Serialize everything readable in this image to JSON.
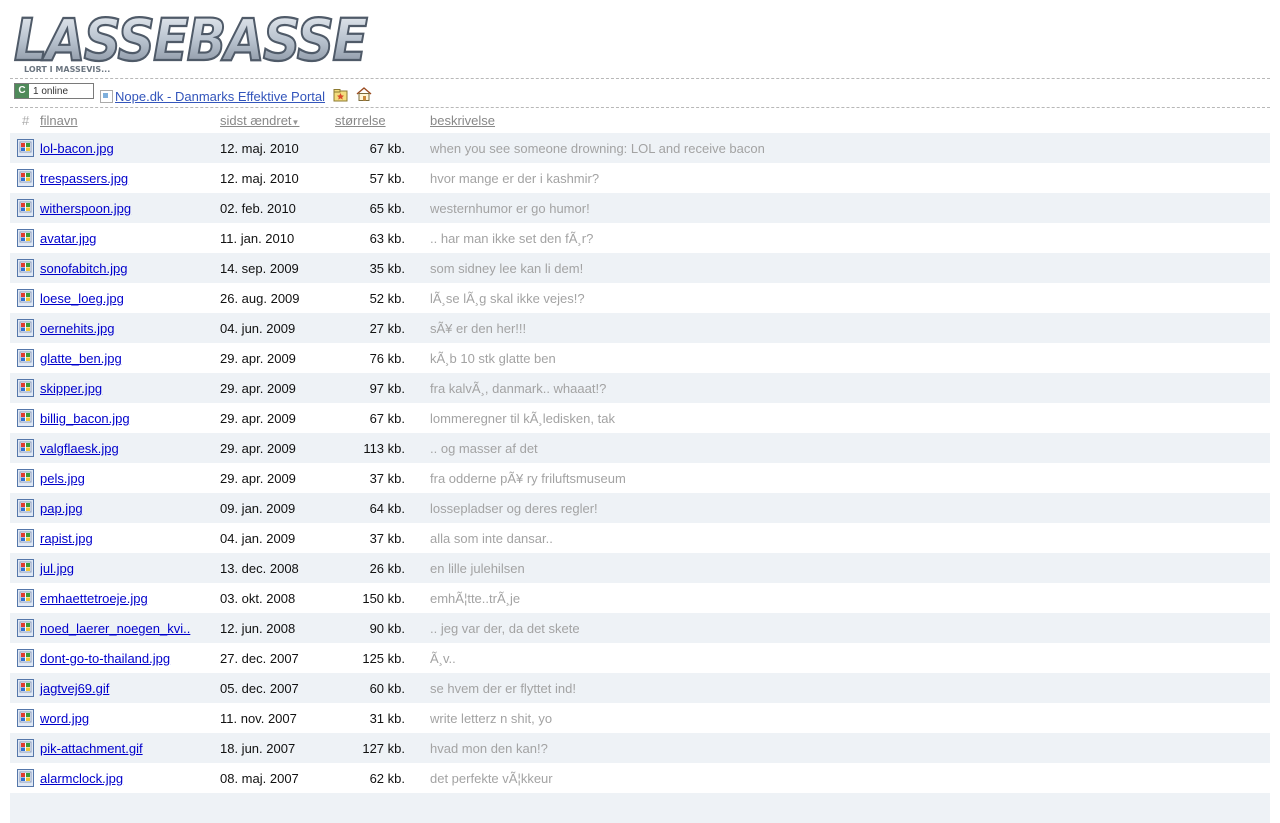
{
  "logo": {
    "main": "LASSEBASSE",
    "tagline": "LORT I MASSEVIS..."
  },
  "counter": {
    "badge": "C",
    "text": "1 online"
  },
  "portal_link": "Nope.dk - Danmarks Effektive Portal",
  "icons": [
    "counter-icon",
    "broken-image-icon",
    "folder-star-icon",
    "home-icon",
    "image-file-icon"
  ],
  "columns": {
    "num": "#",
    "filename": "filnavn",
    "modified": "sidst ændret",
    "size": "størrelse",
    "description": "beskrivelse"
  },
  "files": [
    {
      "name": "lol-bacon.jpg",
      "date": "12. maj. 2010",
      "size": "67 kb.",
      "desc": "when you see someone drowning: LOL and receive bacon"
    },
    {
      "name": "trespassers.jpg",
      "date": "12. maj. 2010",
      "size": "57 kb.",
      "desc": "hvor mange er der i kashmir?"
    },
    {
      "name": "witherspoon.jpg",
      "date": "02. feb. 2010",
      "size": "65 kb.",
      "desc": "westernhumor er go humor!"
    },
    {
      "name": "avatar.jpg",
      "date": "11. jan. 2010",
      "size": "63 kb.",
      "desc": ".. har man ikke set den fÃ¸r?"
    },
    {
      "name": "sonofabitch.jpg",
      "date": "14. sep. 2009",
      "size": "35 kb.",
      "desc": "som sidney lee kan li dem!"
    },
    {
      "name": "loese_loeg.jpg",
      "date": "26. aug. 2009",
      "size": "52 kb.",
      "desc": "lÃ¸se lÃ¸g skal ikke vejes!?"
    },
    {
      "name": "oernehits.jpg",
      "date": "04. jun. 2009",
      "size": "27 kb.",
      "desc": "sÃ¥ er den her!!!"
    },
    {
      "name": "glatte_ben.jpg",
      "date": "29. apr. 2009",
      "size": "76 kb.",
      "desc": "kÃ¸b 10 stk glatte ben"
    },
    {
      "name": "skipper.jpg",
      "date": "29. apr. 2009",
      "size": "97 kb.",
      "desc": "fra kalvÃ¸, danmark.. whaaat!?"
    },
    {
      "name": "billig_bacon.jpg",
      "date": "29. apr. 2009",
      "size": "67 kb.",
      "desc": "lommeregner til kÃ¸ledisken, tak"
    },
    {
      "name": "valgflaesk.jpg",
      "date": "29. apr. 2009",
      "size": "113 kb.",
      "desc": ".. og masser af det"
    },
    {
      "name": "pels.jpg",
      "date": "29. apr. 2009",
      "size": "37 kb.",
      "desc": "fra odderne pÃ¥ ry friluftsmuseum"
    },
    {
      "name": "pap.jpg",
      "date": "09. jan. 2009",
      "size": "64 kb.",
      "desc": "lossepladser og deres regler!"
    },
    {
      "name": "rapist.jpg",
      "date": "04. jan. 2009",
      "size": "37 kb.",
      "desc": "alla som inte dansar.."
    },
    {
      "name": "jul.jpg",
      "date": "13. dec. 2008",
      "size": "26 kb.",
      "desc": "en lille julehilsen"
    },
    {
      "name": "emhaettetroeje.jpg",
      "date": "03. okt. 2008",
      "size": "150 kb.",
      "desc": "emhÃ¦tte..trÃ¸je"
    },
    {
      "name": "noed_laerer_noegen_kvi..",
      "date": "12. jun. 2008",
      "size": "90 kb.",
      "desc": ".. jeg var der, da det skete"
    },
    {
      "name": "dont-go-to-thailand.jpg",
      "date": "27. dec. 2007",
      "size": "125 kb.",
      "desc": "Ã¸v.."
    },
    {
      "name": "jagtvej69.gif",
      "date": "05. dec. 2007",
      "size": "60 kb.",
      "desc": "se hvem der er flyttet ind!"
    },
    {
      "name": "word.jpg",
      "date": "11. nov. 2007",
      "size": "31 kb.",
      "desc": "write letterz n shit, yo"
    },
    {
      "name": "pik-attachment.gif",
      "date": "18. jun. 2007",
      "size": "127 kb.",
      "desc": "hvad mon den kan!?"
    },
    {
      "name": "alarmclock.jpg",
      "date": "08. maj. 2007",
      "size": "62 kb.",
      "desc": "det perfekte vÃ¦kkeur"
    }
  ]
}
